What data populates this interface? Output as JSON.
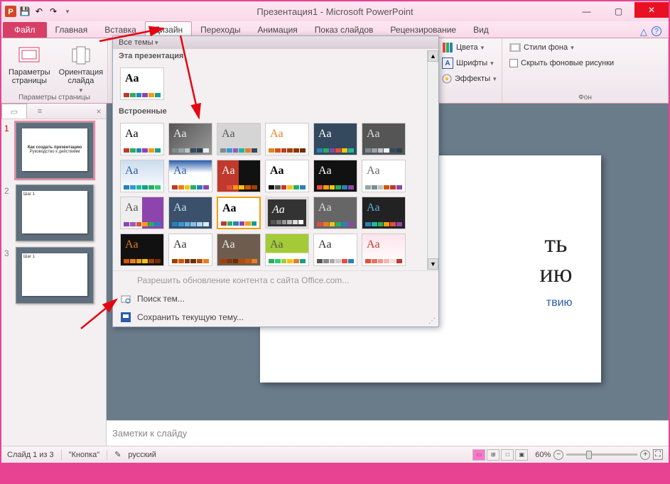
{
  "title": "Презентация1 - Microsoft PowerPoint",
  "qat": {
    "save": "💾",
    "undo": "↶",
    "redo": "↷"
  },
  "tabs": {
    "file": "Файл",
    "items": [
      "Главная",
      "Вставка",
      "Дизайн",
      "Переходы",
      "Анимация",
      "Показ слайдов",
      "Рецензирование",
      "Вид"
    ],
    "active": "Дизайн"
  },
  "ribbon": {
    "page_params": "Параметры\nстраницы",
    "orientation": "Ориентация\nслайда",
    "group_page": "Параметры страницы",
    "colors": "Цвета",
    "fonts": "Шрифты",
    "effects": "Эффекты",
    "bg_styles": "Стили фона",
    "hide_bg": "Скрыть фоновые рисунки",
    "group_bg": "Фон"
  },
  "themes_drop": {
    "all": "Все темы",
    "this_pres": "Эта презентация",
    "builtin": "Встроенные",
    "office_update": "Разрешить обновление контента с сайта Office.com...",
    "search": "Поиск тем...",
    "save_theme": "Сохранить текущую тему..."
  },
  "thumbs": {
    "tab1": "▭",
    "tab2": "≡",
    "slides": [
      {
        "num": "1",
        "title": "Как создать презентацию",
        "sub": "Руководство к действиям"
      },
      {
        "num": "2",
        "title": "Шаг 1",
        "sub": ""
      },
      {
        "num": "3",
        "title": "Шаг 1",
        "sub": ""
      }
    ]
  },
  "slide": {
    "title_suffix": "ть\nию",
    "sub_suffix": "твию"
  },
  "notes": "Заметки к слайду",
  "status": {
    "slide_of": "Слайд 1 из 3",
    "theme": "\"Кнопка\"",
    "lang": "русский",
    "zoom": "60%"
  }
}
